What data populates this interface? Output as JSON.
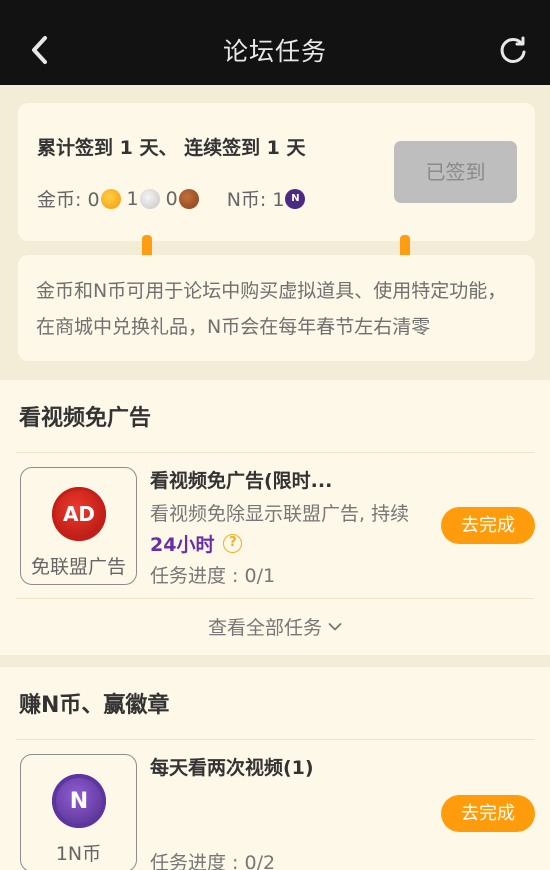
{
  "header": {
    "title": "论坛任务",
    "back_icon": "chevron-left-icon",
    "refresh_icon": "refresh-icon"
  },
  "sign_in": {
    "summary": "累计签到 1 天、 连续签到 1 天",
    "gold_label": "金币: 0",
    "silver_value": "1",
    "bronze_value": "0",
    "ncoin_label": "N币: 1",
    "ncoin_glyph": "N",
    "button_label": "已签到"
  },
  "info": {
    "text": "金币和N币可用于论坛中购买虚拟道具、使用特定功能，在商城中兑换礼品，N币会在每年春节左右清零"
  },
  "section_ads": {
    "title": "看视频免广告",
    "task": {
      "icon_text": "AD",
      "icon_caption": "免联盟广告",
      "title": "看视频免广告(限时...",
      "description": "看视频免除显示联盟广告, 持续",
      "highlight": "24小时",
      "help_icon": "?",
      "progress": "任务进度 : 0/1",
      "button_label": "去完成"
    },
    "view_all": "查看全部任务"
  },
  "section_ncoin": {
    "title": "赚N币、赢徽章",
    "task": {
      "icon_text": "N",
      "icon_caption": "1N币",
      "title": "每天看两次视频(1)",
      "progress": "任务进度 : 0/2",
      "button_label": "去完成"
    }
  },
  "colors": {
    "accent": "#ff9c0c",
    "topbar": "#121212",
    "highlight": "#6a2fa8",
    "card": "#fdf8e8",
    "page": "#f3ecd7"
  }
}
